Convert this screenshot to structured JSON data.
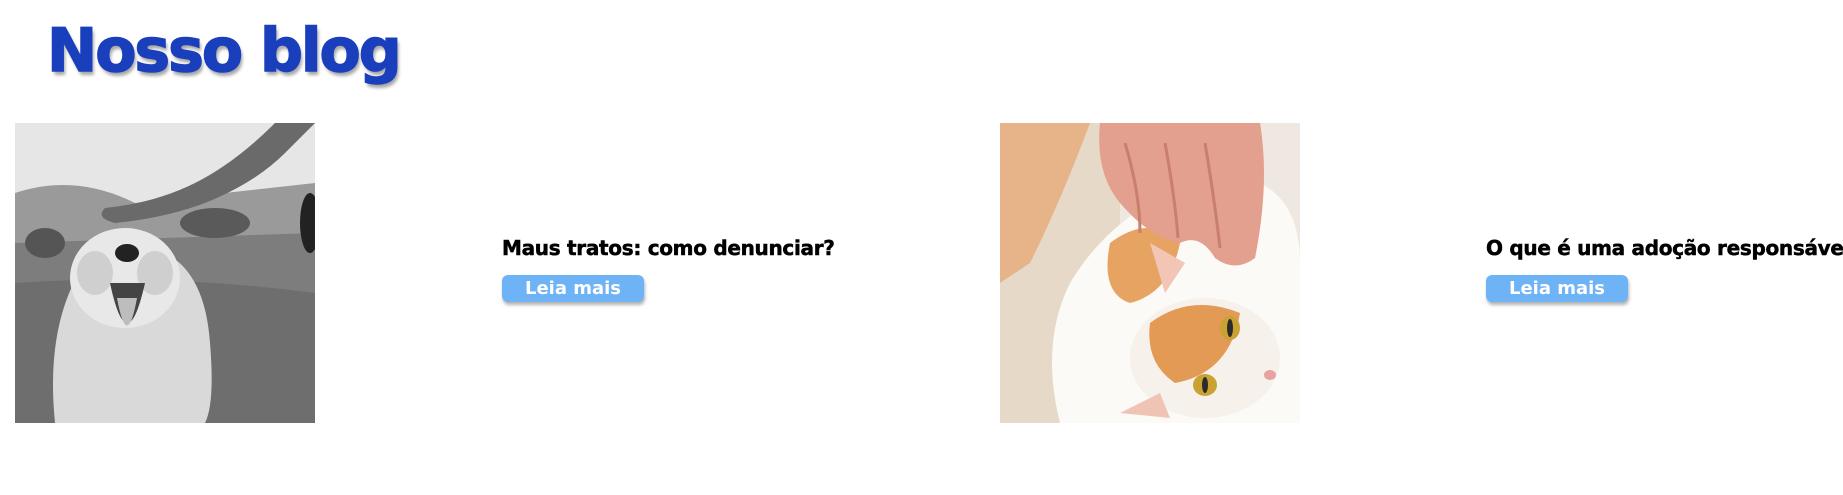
{
  "header": {
    "title": "Nosso blog",
    "title_color": "#1a3fbd"
  },
  "posts": [
    {
      "image_subject": "dog-being-petted-photo",
      "title": "Maus tratos: como denunciar?",
      "button_label": "Leia mais"
    },
    {
      "image_subject": "cat-being-petted-photo",
      "title": "O que é uma adoção responsável?",
      "button_label": "Leia mais"
    }
  ],
  "colors": {
    "button_bg": "#6fb3f7",
    "button_text": "#ffffff",
    "post_title": "#000000"
  }
}
